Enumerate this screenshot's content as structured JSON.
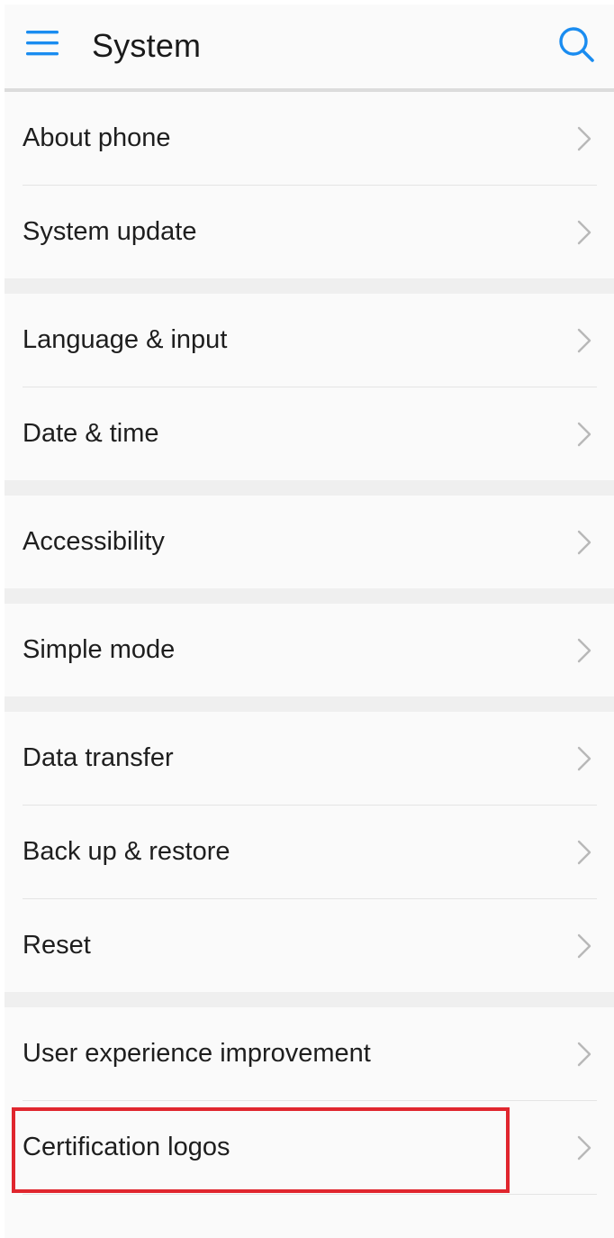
{
  "header": {
    "title": "System",
    "menu_icon": "hamburger-menu-icon",
    "search_icon": "search-icon"
  },
  "colors": {
    "accent": "#1a8cf0",
    "highlight": "#e0262e",
    "text": "#1e1e1e",
    "chevron": "#b8b8b8"
  },
  "groups": [
    {
      "items": [
        {
          "label": "About phone"
        },
        {
          "label": "System update"
        }
      ]
    },
    {
      "items": [
        {
          "label": "Language & input"
        },
        {
          "label": "Date & time"
        }
      ]
    },
    {
      "items": [
        {
          "label": "Accessibility"
        }
      ]
    },
    {
      "items": [
        {
          "label": "Simple mode"
        }
      ]
    },
    {
      "items": [
        {
          "label": "Data transfer"
        },
        {
          "label": "Back up & restore"
        },
        {
          "label": "Reset"
        }
      ]
    },
    {
      "items": [
        {
          "label": "User experience improvement"
        },
        {
          "label": "Certification logos",
          "highlighted": true
        }
      ]
    }
  ]
}
